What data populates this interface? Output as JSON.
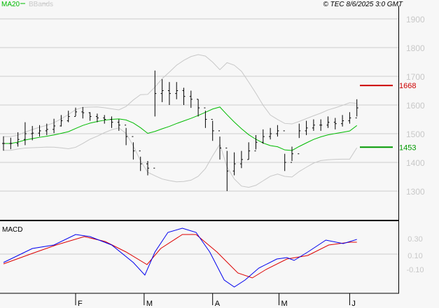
{
  "legend": {
    "ma_label": "MA20",
    "bb_label": "BBands",
    "ma_color": "#00bb00",
    "bb_color": "#c8c8c8"
  },
  "copyright": "© TEC 8/6/2025 3:0 GMT",
  "macd_title": "MACD",
  "levels": {
    "resistance": {
      "value": 1668,
      "label": "1668",
      "color": "#cc0000"
    },
    "support": {
      "value": 1453,
      "label": "1453",
      "color": "#009900"
    }
  },
  "chart_data": {
    "type": "ohlc",
    "price_axis": {
      "ticks": [
        1300,
        1400,
        1500,
        1600,
        1700,
        1800,
        1900
      ],
      "labels": [
        "1300",
        "1400",
        "1500",
        "1600",
        "1700",
        "1800",
        "1900"
      ],
      "range": [
        1215,
        1965
      ]
    },
    "macd_axis": {
      "ticks": [
        0.3,
        0.1,
        -0.1
      ],
      "labels": [
        "0.30",
        "0.10",
        "-0.10"
      ],
      "gridline": 0.1,
      "range": [
        -0.45,
        0.45
      ]
    },
    "months": [
      {
        "label": "F",
        "bar": 10
      },
      {
        "label": "M",
        "bar": 19.5
      },
      {
        "label": "A",
        "bar": 29
      },
      {
        "label": "M",
        "bar": 38.2
      },
      {
        "label": "J",
        "bar": 48
      }
    ],
    "close": [
      1466,
      1466,
      1480,
      1500,
      1502,
      1510,
      1515,
      1527,
      1545,
      1560,
      1576,
      1573,
      1560,
      1555,
      1550,
      1540,
      1530,
      1490,
      1440,
      1395,
      1380,
      1640,
      1650,
      1640,
      1650,
      1630,
      1620,
      1590,
      1550,
      1510,
      1450,
      1370,
      1395,
      1410,
      1440,
      1470,
      1490,
      1500,
      1510,
      1400,
      1430,
      1510,
      1520,
      1530,
      1530,
      1540,
      1535,
      1545,
      1555,
      1590
    ],
    "range": [
      25,
      20,
      25,
      40,
      25,
      20,
      20,
      25,
      20,
      20,
      15,
      20,
      15,
      15,
      15,
      20,
      20,
      30,
      30,
      25,
      25,
      80,
      40,
      40,
      30,
      30,
      30,
      30,
      30,
      35,
      40,
      70,
      40,
      30,
      30,
      25,
      25,
      20,
      20,
      30,
      25,
      25,
      25,
      20,
      20,
      20,
      20,
      20,
      20,
      30
    ],
    "ma_period_bars": 10,
    "macd": [
      [
        0,
        -0.02
      ],
      [
        4,
        0.18
      ],
      [
        7,
        0.23
      ],
      [
        10,
        0.38
      ],
      [
        12,
        0.35
      ],
      [
        15,
        0.23
      ],
      [
        18,
        -0.02
      ],
      [
        19.6,
        -0.2
      ],
      [
        21,
        0.13
      ],
      [
        22.8,
        0.41
      ],
      [
        24.8,
        0.47
      ],
      [
        26.7,
        0.41
      ],
      [
        28.6,
        0.13
      ],
      [
        30.6,
        -0.27
      ],
      [
        32,
        -0.37
      ],
      [
        33.5,
        -0.27
      ],
      [
        35.4,
        -0.1
      ],
      [
        37.9,
        0.03
      ],
      [
        39.3,
        0.05
      ],
      [
        40.3,
        0.01
      ],
      [
        42.2,
        0.13
      ],
      [
        44.7,
        0.3
      ],
      [
        47.1,
        0.25
      ],
      [
        49,
        0.31
      ]
    ],
    "signal": [
      [
        0,
        -0.04
      ],
      [
        4,
        0.11
      ],
      [
        7.3,
        0.23
      ],
      [
        11.2,
        0.35
      ],
      [
        14.1,
        0.28
      ],
      [
        17,
        0.13
      ],
      [
        19.9,
        -0.05
      ],
      [
        21.8,
        0.18
      ],
      [
        24.8,
        0.38
      ],
      [
        26.7,
        0.38
      ],
      [
        29.6,
        0.13
      ],
      [
        32.5,
        -0.17
      ],
      [
        34.5,
        -0.24
      ],
      [
        36.4,
        -0.12
      ],
      [
        39.3,
        0.03
      ],
      [
        42.2,
        0.08
      ],
      [
        45.1,
        0.23
      ],
      [
        48,
        0.27
      ],
      [
        49,
        0.27
      ]
    ]
  }
}
